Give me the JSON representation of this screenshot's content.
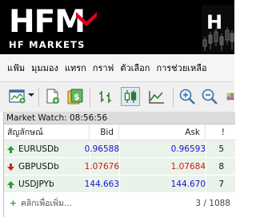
{
  "brand": {
    "logo_main": "HFM",
    "logo_sub": "HF MARKETS"
  },
  "menu": [
    "แฟ้ม",
    "มุมมอง",
    "แทรก",
    "กราฟ",
    "ตัวเลือก",
    "การช่วยเหลือ"
  ],
  "toolbar_icons": [
    "new-chart-icon",
    "dropdown-arrow-icon",
    "new-profile-icon",
    "market-icon",
    "bar-chart-icon",
    "candlestick-icon",
    "line-chart-icon",
    "zoom-in-icon",
    "zoom-out-icon",
    "tile-windows-icon"
  ],
  "market_watch": {
    "title": "Market Watch: 08:56:56",
    "headers": {
      "symbol": "สัญลักษณ์",
      "bid": "Bid",
      "ask": "Ask",
      "spread": "!"
    },
    "rows": [
      {
        "symbol": "EURUSDb",
        "bid": "0.96588",
        "ask": "0.96593",
        "spread": "5",
        "direction": "up"
      },
      {
        "symbol": "GBPUSDb",
        "bid": "1.07676",
        "ask": "1.07684",
        "spread": "8",
        "direction": "down"
      },
      {
        "symbol": "USDJPYb",
        "bid": "144.663",
        "ask": "144.670",
        "spread": "7",
        "direction": "up"
      }
    ],
    "add_label": "คลิกเพื่อเพิ่ม...",
    "count": "3 / 1088"
  },
  "colors": {
    "up": "#1515cc",
    "down": "#c81818",
    "up_arrow": "#2e9a2e",
    "down_arrow": "#cc2222",
    "brand_red": "#e0001b"
  }
}
